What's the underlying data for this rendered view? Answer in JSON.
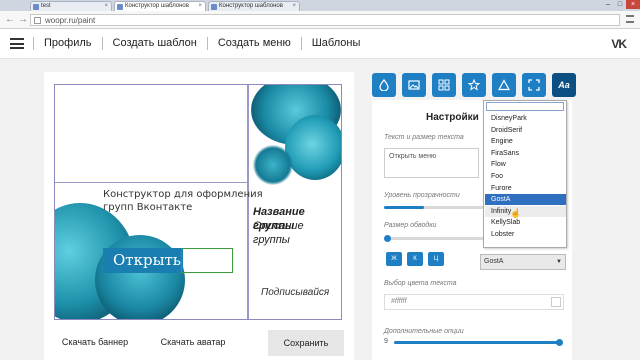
{
  "browser": {
    "tabs": [
      {
        "title": "test"
      },
      {
        "title": "Конструктор шаблонов"
      },
      {
        "title": "Конструктор шаблонов"
      }
    ],
    "url": "woopr.ru/paint"
  },
  "nav": {
    "links": [
      "Профиль",
      "Создать шаблон",
      "Создать меню",
      "Шаблоны"
    ],
    "logo": "VK"
  },
  "canvas": {
    "banner_text_line1": "Конструктор для оформления",
    "banner_text_line2": "групп Вконтакте",
    "open_button": "Открыть меню",
    "group_name": "Название группы",
    "group_desc": "Описание группы",
    "subscribe": "Подписывайся"
  },
  "left_actions": {
    "download_banner": "Скачать баннер",
    "download_avatar": "Скачать аватар",
    "save": "Сохранить"
  },
  "toolbar": {
    "icons": [
      "drop-icon",
      "image-icon",
      "grid-icon",
      "star-icon",
      "triangle-icon",
      "fullscreen-icon",
      "font-icon"
    ],
    "font_label": "Aa"
  },
  "settings": {
    "title": "Настройки",
    "text_size_label": "Текст и размер текста",
    "text_value": "Открыть меню",
    "opacity_label": "Уровень прозрачности",
    "opacity_level": 0.4,
    "stroke_label": "Размер обводки",
    "stroke_level": 0.0,
    "format_buttons": [
      "Ж",
      "К",
      "Ц"
    ],
    "color_label": "Выбор цвета текста",
    "color_value": "#ffffff",
    "extra_label": "Дополнительные опции",
    "extra_value": "9",
    "selected_font": "GostA"
  },
  "font_list": {
    "items": [
      "DisneyPark",
      "DroidSerif",
      "Engine",
      "FiraSans",
      "Flow",
      "Foo",
      "Furore",
      "GostA",
      "Infinity",
      "KellySlab",
      "Lobster"
    ],
    "selected": "GostA",
    "hovered": "Infinity"
  },
  "colors": {
    "accent": "#1e7fc4",
    "accent_dark": "#0c4f82",
    "splash": "#1d9bb5"
  }
}
